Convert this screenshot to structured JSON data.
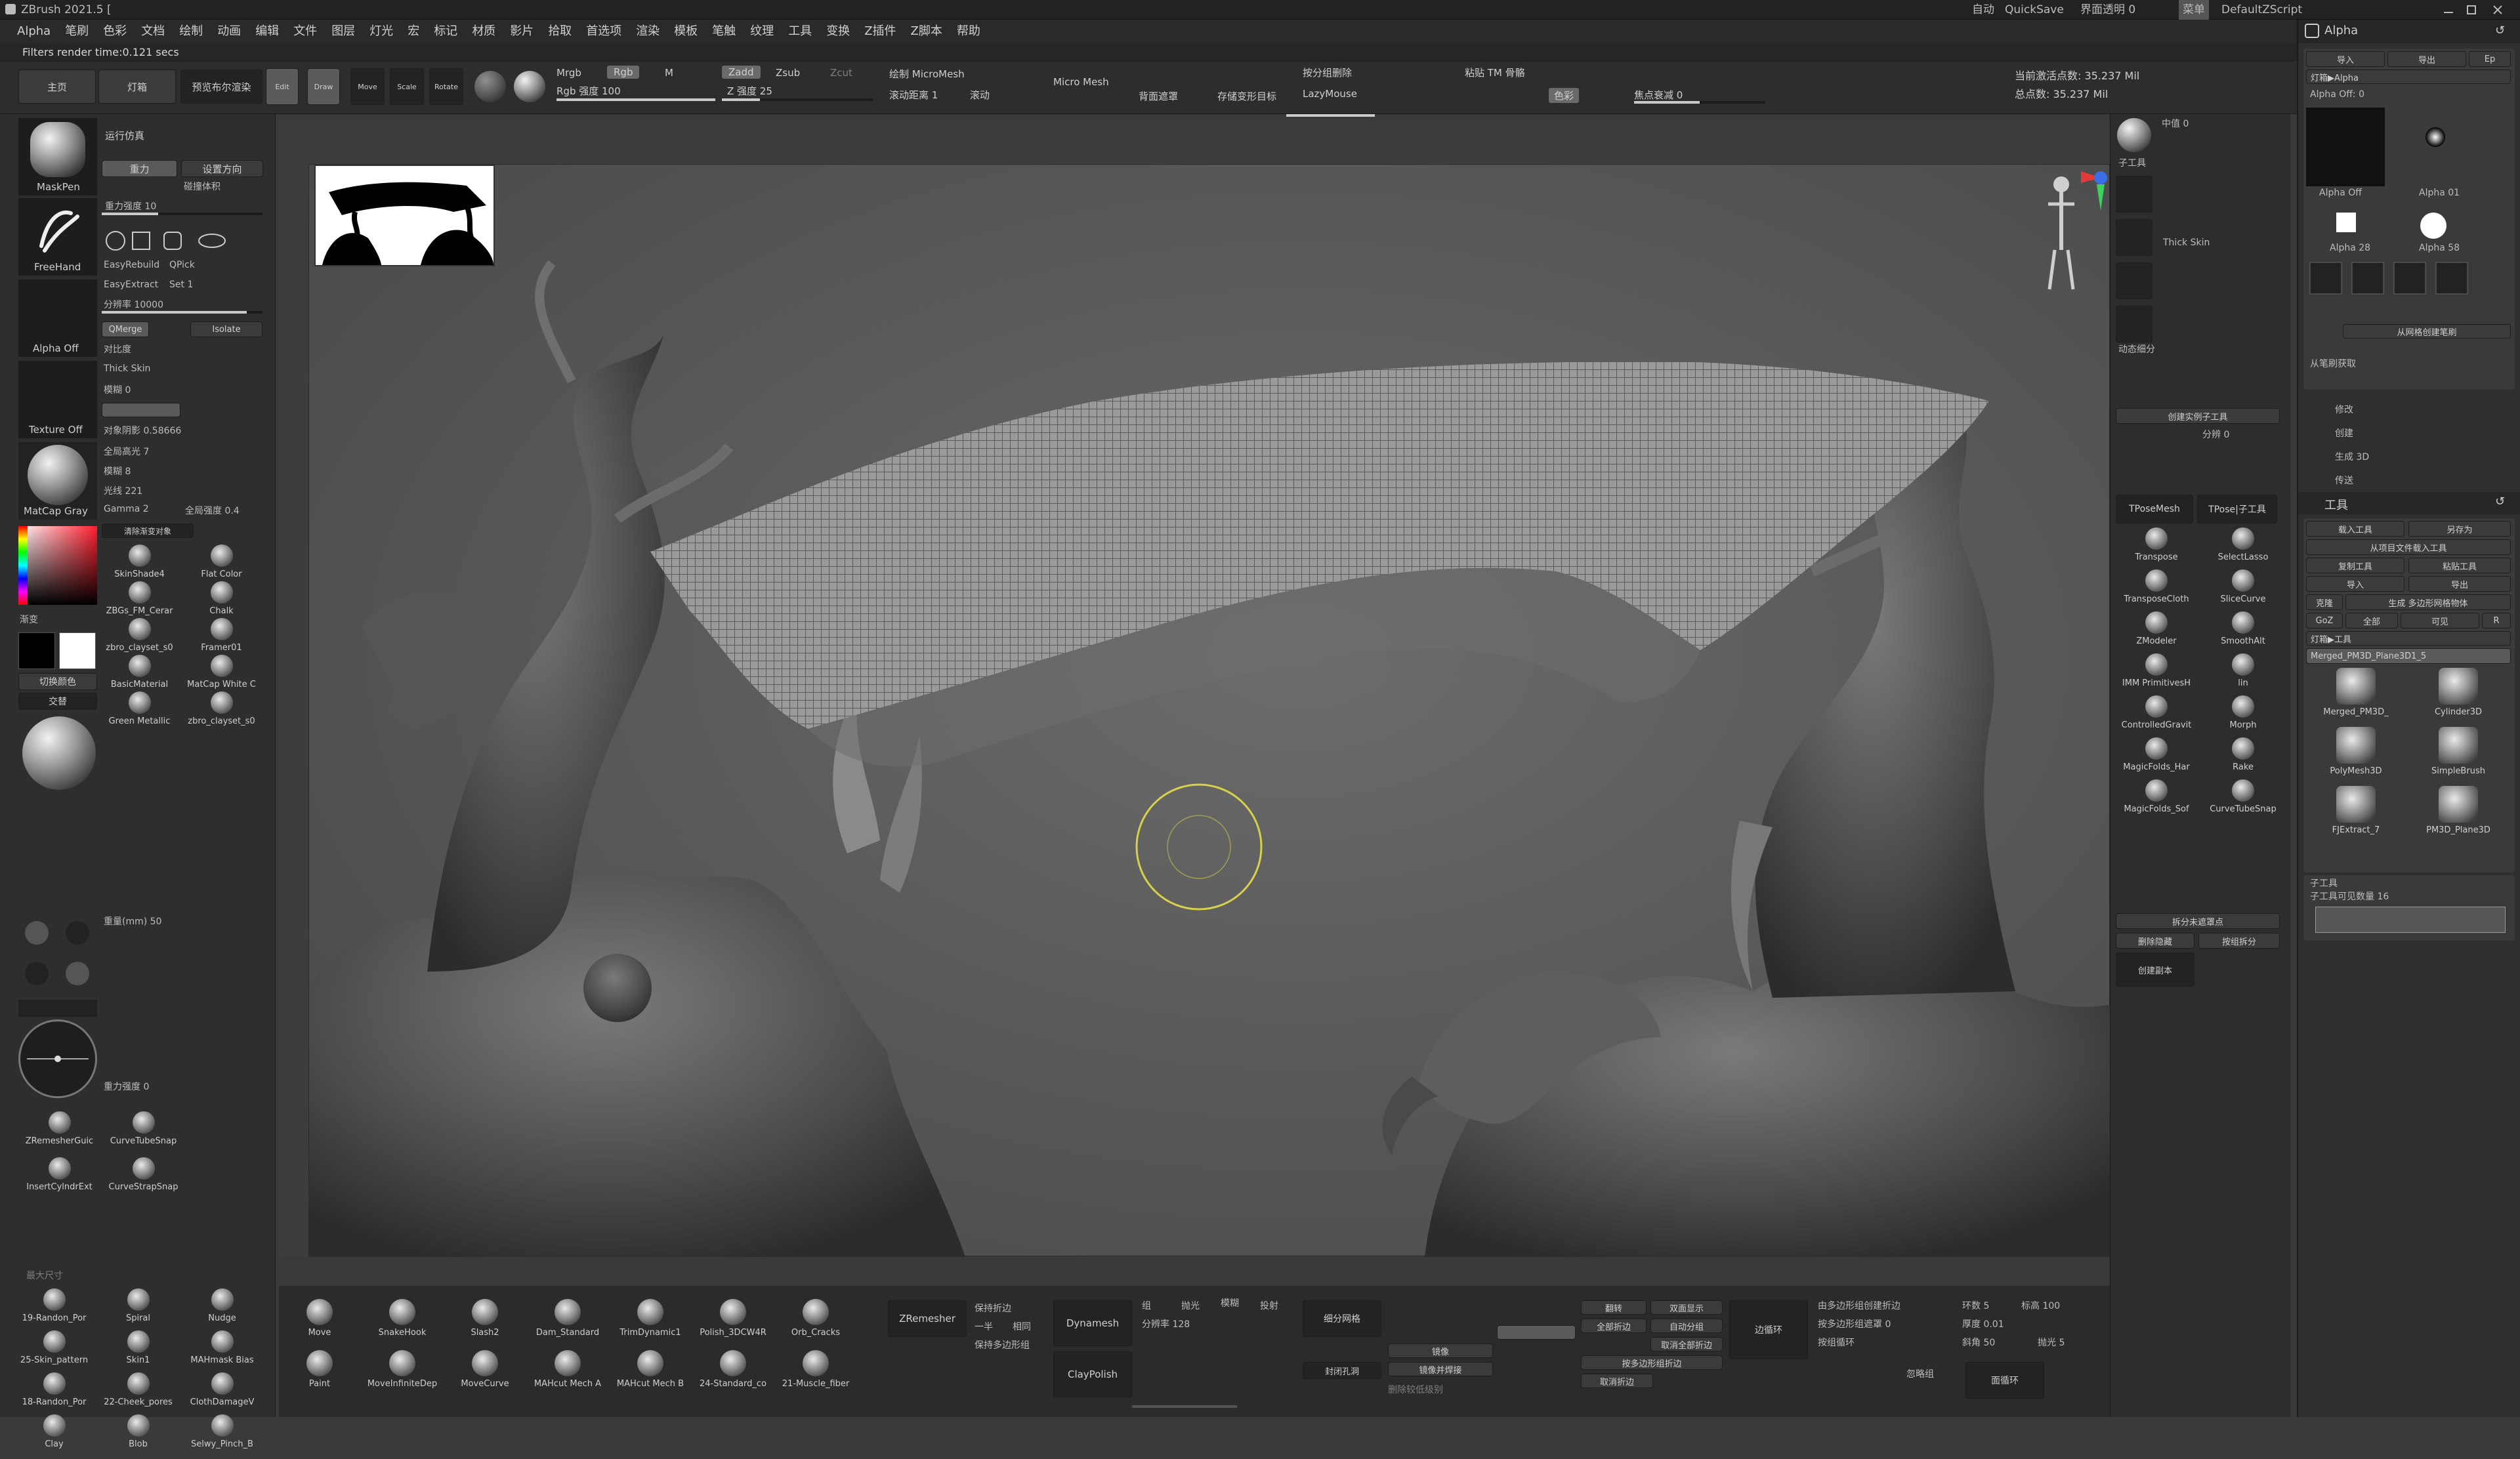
{
  "titlebar": {
    "app_title": "ZBrush 2021.5 [",
    "autosave": "自动",
    "quicksave": "QuickSave",
    "transparency": "界面透明 0",
    "menus_label": "菜单",
    "default_zscript": "DefaultZScript"
  },
  "menubar": {
    "items": [
      "Alpha",
      "笔刷",
      "色彩",
      "文档",
      "绘制",
      "动画",
      "编辑",
      "文件",
      "图层",
      "灯光",
      "宏",
      "标记",
      "材质",
      "影片",
      "拾取",
      "首选项",
      "渲染",
      "模板",
      "笔触",
      "纹理",
      "工具",
      "变换",
      "Z插件",
      "Z脚本",
      "帮助"
    ]
  },
  "status": {
    "render_time": "Filters render time:0.121 secs",
    "active_points": "当前激活点数: 35.237 Mil",
    "total_points": "总点数: 35.237 Mil"
  },
  "top_shelf": {
    "home": "主页",
    "lightbox": "灯箱",
    "preview_render": "预览布尔渲染",
    "edit": "Edit",
    "draw": "Draw",
    "move": "Move",
    "scale": "Scale",
    "rotate": "Rotate",
    "mrgb": "Mrgb",
    "rgb": "Rgb",
    "m": "M",
    "rgb_intensity": "Rgb 强度 100",
    "zadd": "Zadd",
    "zsub": "Zsub",
    "zcut": "Zcut",
    "z_intensity": "Z 强度 25",
    "draw_micromesh": "绘制 MicroMesh",
    "micro_mesh": "Micro Mesh",
    "scroll_distance": "滚动距离 1",
    "scroll": "滚动",
    "backface_mask": "背面遮罩",
    "store_morph": "存储变形目标",
    "lazymouse": "LazyMouse",
    "delete_by_fold": "按分组删除",
    "paste_tm": "粘贴 TM 骨骼",
    "color_label": "色彩",
    "focal_shift": "焦点衰减 0"
  },
  "left_panel": {
    "maskpen": "MaskPen",
    "freehand": "FreeHand",
    "alpha_off": "Alpha Off",
    "texture_off": "Texture Off",
    "matcap_gray": "MatCap Gray",
    "run_sim": "运行仿真",
    "gravity": "重力",
    "set_direction": "设置方向",
    "collision_volume": "碰撞体积",
    "gravity_strength": "重力强度 10",
    "easyrebuild": "EasyRebuild",
    "qpick": "QPick",
    "easyextract": "EasyExtract",
    "set1": "Set 1",
    "resolution": "分辨率 10000",
    "qmerge": "QMerge",
    "isolate": "Isolate",
    "symmetry": "对比度",
    "thick_skin": "Thick Skin",
    "blur": "模糊 0",
    "shadow": "对象阴影 0.58666",
    "highlight": "全局高光 7",
    "blur2": "模糊 8",
    "rays": "光线 221",
    "gamma": "Gamma 2",
    "global_intensity": "全局强度 0.4",
    "clear_gradient": "清除渐变对象",
    "gradient": "渐变",
    "switch_color": "切换颜色",
    "alternate": "交替",
    "stroke_radius": "重力强度 0",
    "materials": [
      "SkinShade4",
      "Flat Color",
      "ZBGs_FM_Cerar",
      "Chalk",
      "zbro_clayset_s0",
      "Framer01",
      "BasicMaterial",
      "MatCap White C",
      "Green Metallic",
      "zbro_clayset_s0"
    ],
    "brush_size": "重量(mm) 50",
    "tools": [
      "ZRemesherGuic",
      "CurveTubeSnap",
      "InsertCylndrExt",
      "CurveStrapSnap"
    ],
    "brushes": [
      "19-Randon_Por",
      "Spiral",
      "Nudge",
      "25-Skin_pattern",
      "Skin1",
      "MAHmask Bias",
      "18-Randon_Por",
      "22-Cheek_pores",
      "ClothDamageV",
      "Clay",
      "Blob",
      "Selwy_Pinch_B"
    ],
    "max_size": "最大尺寸"
  },
  "right_panel": {
    "medium": "中值 0",
    "sub_tool": "子工具",
    "thick_skin": "Thick Skin",
    "dynamic_subdiv": "动态细分",
    "create_instance": "创建实例子工具",
    "div": "分辨 0",
    "tposemesh": "TPoseMesh",
    "tpose_subtool": "TPose|子工具",
    "items": [
      "Transpose",
      "SelectLasso",
      "TransposeCloth",
      "SliceCurve",
      "ZModeler",
      "SmoothAlt",
      "IMM PrimitivesH",
      "lin",
      "ControlledGravit",
      "Morph",
      "MagicFolds_Har",
      "Rake",
      "MagicFolds_Sof",
      "CurveTubeSnap"
    ],
    "split_hidden": "拆分未遮罩点",
    "delete_hidden": "删除隐藏",
    "group_split": "按组拆分",
    "create_copy": "创建副本"
  },
  "tray": {
    "alpha_title": "Alpha",
    "import": "导入",
    "export": "导出",
    "ep": "Ep",
    "lightbox_alpha": "灯箱▶Alpha",
    "alpha_off_val": "Alpha Off: 0",
    "alphas": [
      "Alpha Off",
      "Alpha 01",
      "Alpha 28",
      "Alpha 58"
    ],
    "modify": "修改",
    "create": "创建",
    "make_3d": "生成 3D",
    "transfer": "传送",
    "from_brush": "从笔刷获取",
    "from_mesh": "从网格创建笔刷",
    "tool_title": "工具",
    "load_tool": "载入工具",
    "save_as": "另存为",
    "load_from_project": "从项目文件载入工具",
    "copy_tool": "复制工具",
    "paste_tool": "粘贴工具",
    "import_tool": "导入",
    "export_tool": "导出",
    "clone": "克隆",
    "make_polymesh": "生成 多边形网格物体",
    "goz": "GoZ",
    "all": "全部",
    "visible": "可见",
    "r": "R",
    "lightbox_tool": "灯箱▶工具",
    "current_tool": "Merged_PM3D_Plane3D1_5",
    "tools": [
      "Merged_PM3D_",
      "Cylinder3D",
      "PolyMesh3D",
      "SimpleBrush",
      "FJExtract_7",
      "PM3D_Plane3D"
    ],
    "subtool_title": "子工具",
    "subtool_count": "子工具可见数量 16"
  },
  "bottom_shelf": {
    "brushes": [
      "Move",
      "SnakeHook",
      "Slash2",
      "Dam_Standard",
      "TrimDynamic1",
      "Polish_3DCW4R",
      "Orb_Cracks",
      "Paint",
      "MoveInfiniteDep",
      "MoveCurve",
      "MAHcut Mech A",
      "MAHcut Mech B",
      "24-Standard_co",
      "21-Muscle_fiber"
    ],
    "zremesher": "ZRemesher",
    "keep_creases": "保持折边",
    "half": "一半",
    "same": "相同",
    "keep_poly": "保持多边形组",
    "dynamesh": "Dynamesh",
    "group": "组",
    "project": "投影",
    "blur": "模糊",
    "projection": "投射",
    "resolution": "分辨率 128",
    "claypolish": "ClayPolish",
    "subdiv_mesh": "细分网格",
    "mirror": "镜像",
    "mirror_weld": "镜像并焊接",
    "close_holes": "封闭孔洞",
    "delete_lower": "删除较低级别",
    "flip": "翻转",
    "double": "双面显示",
    "reconstruct": "全部折边",
    "auto_group": "自动分组",
    "uncrease_all": "取消全部折边",
    "crease_by_group": "按多边形组折边",
    "uncrease": "取消折边",
    "edge_loop": "边循环",
    "mask_edge": "由多边形组创建折边",
    "group_loops": "按多边形组遮罩 0",
    "by_group_loop": "按组循环",
    "loops": "环数 5",
    "polish_label": "抛光",
    "bevel": "斜角 50",
    "polish_5": "抛光 5",
    "bevel_100": "标高 100",
    "thickness": "厚度 0.01",
    "ignore_groups": "忽略组",
    "face_loop": "面循环"
  },
  "colors": {
    "accent": "#c8c8c8",
    "primary_color": "#000000",
    "secondary_color": "#ffffff",
    "brush_cursor": "#d6d04a"
  }
}
